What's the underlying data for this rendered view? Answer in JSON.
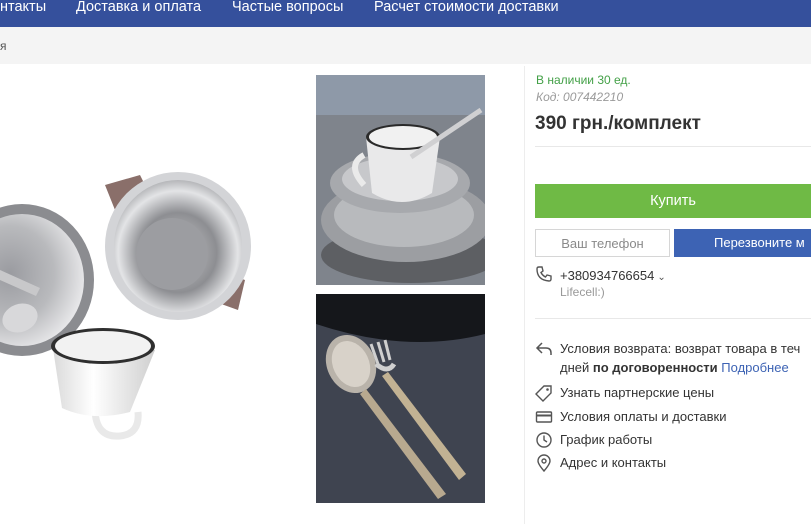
{
  "nav": {
    "items": [
      {
        "label": "нтакты"
      },
      {
        "label": "Доставка и оплата"
      },
      {
        "label": "Частые вопросы"
      },
      {
        "label": "Расчет стоимости доставки"
      }
    ]
  },
  "breadcrumb": {
    "text": "я"
  },
  "product": {
    "availability": "В наличии 30 ед.",
    "code": "Код: 007442210",
    "price": "390 грн./комплект"
  },
  "actions": {
    "buy_label": "Купить",
    "phone_placeholder": "Ваш телефон",
    "callback_label": "Перезвоните м"
  },
  "contact": {
    "phone": "+380934766654",
    "operator": "Lifecell:)"
  },
  "info": {
    "return_label": "Условия возврата: возврат товара в теч",
    "return_line2_prefix": "дней ",
    "return_bold": "по договоренности",
    "return_more": "Подробнее",
    "partner_prices": "Узнать партнерские цены",
    "payment_delivery": "Условия оплаты и доставки",
    "schedule": "График работы",
    "address": "Адрес и контакты"
  },
  "colors": {
    "nav_bg": "#35509c",
    "buy_green": "#6fba45",
    "callback_blue": "#3d63b4",
    "stock_green": "#43a047",
    "link_blue": "#3d63b4"
  },
  "icons": [
    "phone-icon",
    "return-arrow-icon",
    "tag-icon",
    "card-icon",
    "clock-icon",
    "location-pin-icon",
    "chevron-down-icon"
  ]
}
